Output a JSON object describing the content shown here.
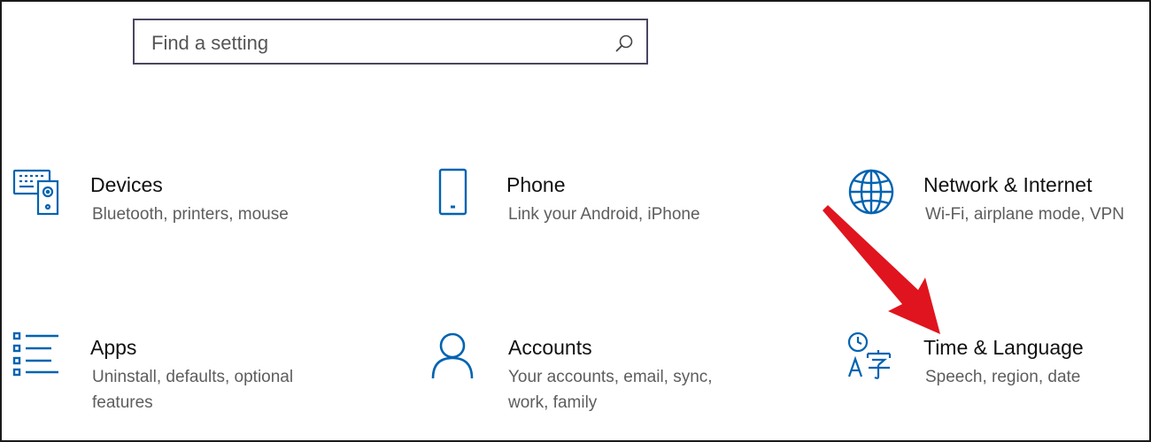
{
  "search": {
    "placeholder": "Find a setting",
    "icon": "search-icon"
  },
  "tiles": [
    {
      "title": "Devices",
      "description": "Bluetooth, printers, mouse",
      "icon": "devices-icon"
    },
    {
      "title": "Phone",
      "description": "Link your Android, iPhone",
      "icon": "phone-icon"
    },
    {
      "title": "Network & Internet",
      "description": "Wi-Fi, airplane mode, VPN",
      "icon": "globe-icon"
    },
    {
      "title": "Apps",
      "description": "Uninstall, defaults, optional features",
      "icon": "apps-list-icon"
    },
    {
      "title": "Accounts",
      "description": "Your accounts, email, sync, work, family",
      "icon": "person-icon"
    },
    {
      "title": "Time & Language",
      "description": "Speech, region, date",
      "icon": "time-language-icon"
    }
  ],
  "colors": {
    "accent": "#0063b1",
    "annotation_arrow": "#e0141e",
    "border": "#4b4560"
  }
}
